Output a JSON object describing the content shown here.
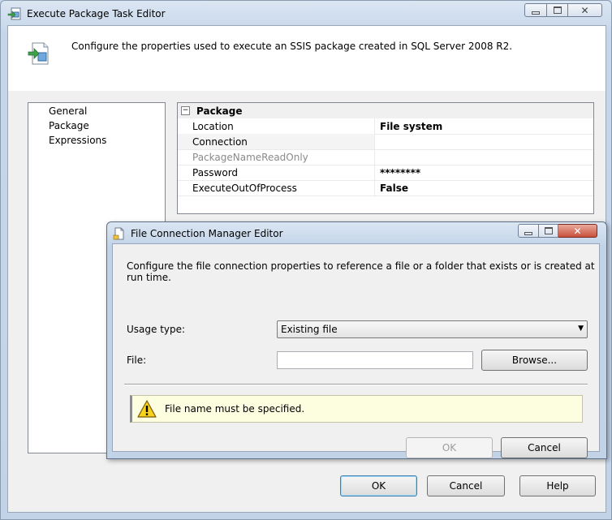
{
  "main_window": {
    "title": "Execute Package Task Editor",
    "description": "Configure the properties used to execute an SSIS package created in SQL Server 2008 R2.",
    "nav_items": [
      "General",
      "Package",
      "Expressions"
    ],
    "grid": {
      "category": "Package",
      "rows": [
        {
          "name": "Location",
          "value": "File system"
        },
        {
          "name": "Connection",
          "value": ""
        },
        {
          "name": "PackageNameReadOnly",
          "value": ""
        },
        {
          "name": "Password",
          "value": "********"
        },
        {
          "name": "ExecuteOutOfProcess",
          "value": "False"
        }
      ]
    },
    "buttons": {
      "ok": "OK",
      "cancel": "Cancel",
      "help": "Help"
    }
  },
  "dialog": {
    "title": "File Connection Manager Editor",
    "description": "Configure the file connection properties to reference a file or a folder that exists or is created at run time.",
    "usage_label": "Usage type:",
    "usage_value": "Existing file",
    "file_label": "File:",
    "file_value": "",
    "browse_label": "Browse...",
    "warning": "File name must be specified.",
    "ok_label": "OK",
    "cancel_label": "Cancel"
  },
  "icons": {
    "title": "package-task-icon",
    "header": "package-config-icon",
    "dialog": "file-icon",
    "warning": "warning-icon"
  },
  "colors": {
    "title_bar": "#c6d6ea",
    "warning_bg": "#fdfde0",
    "default_button_border": "#3c7fb1"
  }
}
